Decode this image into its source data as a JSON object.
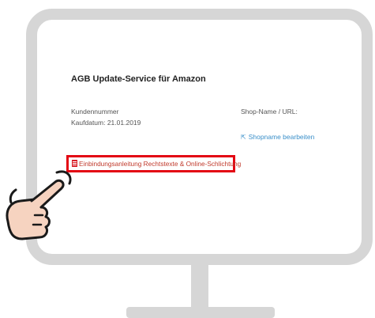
{
  "page": {
    "product_title": "AGB Update-Service für Amazon",
    "customer_number_label": "Kundennummer",
    "purchase_date": "Kaufdatum: 21.01.2019",
    "shop_name_label": "Shop-Name / URL:",
    "edit_shopname_link": "Shopname bearbeiten",
    "integration_link": "Einbindungsanleitung Rechtstexte & Online-Schlichtung"
  },
  "colors": {
    "highlight": "#e30613",
    "link": "#3a8fc9",
    "monitor_frame": "#d6d6d6"
  },
  "icons": {
    "edit_icon": "external-edit-icon",
    "pdf_icon": "pdf-icon",
    "hand_icon": "pointing-hand-icon"
  }
}
